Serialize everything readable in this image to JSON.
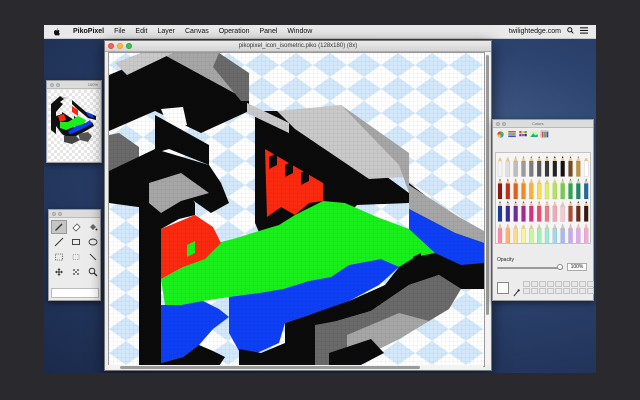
{
  "menubar": {
    "app_name": "PikoPixel",
    "items": [
      "File",
      "Edit",
      "Layer",
      "Canvas",
      "Operation",
      "Panel",
      "Window"
    ],
    "host": "twilightedge.com",
    "icons": [
      "apple-icon",
      "search-icon",
      "list-icon"
    ]
  },
  "preview_panel": {
    "zoom_label": "100%"
  },
  "document": {
    "title": "pikopixel_icon_isometric.piko (128x180) (8x)",
    "colors": {
      "checker_light": "#ffffff",
      "checker_dark": "#d3e9fb",
      "black": "#0b0b0b",
      "light_gray": "#c9c9c9",
      "mid_gray": "#a6a6a6",
      "dark_gray": "#6a6a6a",
      "red": "#fa2a10",
      "green": "#19f01b",
      "blue": "#0f3ff2"
    }
  },
  "tools_panel": {
    "tools": [
      "pencil-tool",
      "eraser-tool",
      "fill-tool",
      "line-tool",
      "rectangle-tool",
      "ellipse-tool",
      "selection-tool",
      "freehand-selection-tool",
      "wand-tool",
      "move-tool",
      "magic-wand-tool",
      "magnifier-tool"
    ],
    "selected": "pencil-tool"
  },
  "colors_panel": {
    "title": "Colors",
    "modes": [
      "color-wheel-icon",
      "color-sliders-icon",
      "color-palettes-icon",
      "image-palettes-icon",
      "crayon-icon"
    ],
    "selected_mode": "crayon-icon",
    "opacity_label": "Opacity",
    "opacity_value": "100%",
    "opacity_fraction": 1.0,
    "current_color": "#ffffff",
    "pencil_colors": [
      [
        "#f4f4f4",
        "#e0e0e0",
        "#bdbdbd",
        "#9b9b9b",
        "#7c7c7c",
        "#5a5a5a",
        "#3b3b3b",
        "#222222",
        "#111111",
        "#7a4a18",
        "#c0903a",
        "#ffffff"
      ],
      [
        "#8a1c10",
        "#c03018",
        "#e65f1a",
        "#f08a28",
        "#f4b43a",
        "#f4dd58",
        "#dff064",
        "#b5e64f",
        "#6fd23c",
        "#2aa84a",
        "#178a6a",
        "#1f6aa0"
      ],
      [
        "#1a3d9c",
        "#3b2b9a",
        "#6a2c9e",
        "#a6288e",
        "#d33083",
        "#e84f6a",
        "#f07a8a",
        "#f4a7b5",
        "#f6c9d4",
        "#b24b2e",
        "#6b2d14",
        "#3a1a0c"
      ],
      [
        "#ff8aa5",
        "#ffb06b",
        "#ffd98c",
        "#f5f59a",
        "#c9f59d",
        "#9ff0b4",
        "#98ecd8",
        "#9dd9f4",
        "#a7b9f4",
        "#c6a7f4",
        "#e2a7f4",
        "#f4a7d9"
      ]
    ]
  }
}
